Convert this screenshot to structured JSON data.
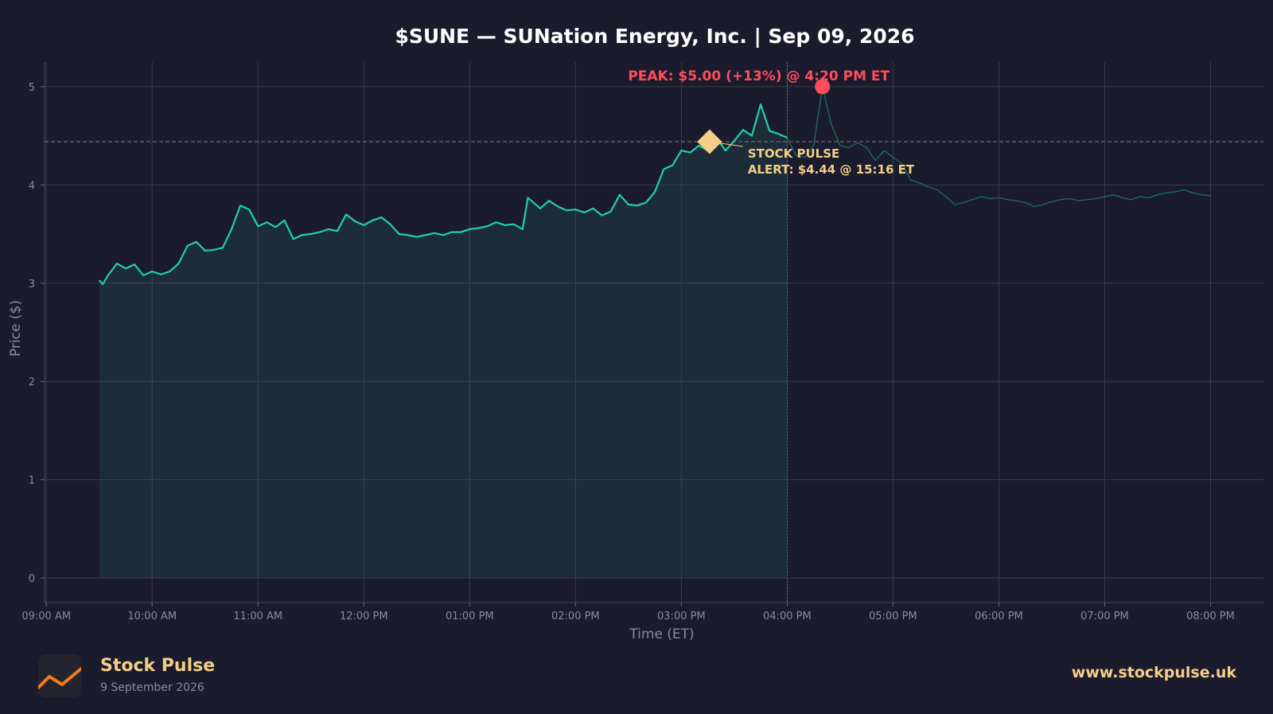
{
  "chart_data": {
    "type": "line",
    "title": "$SUNE — SUNation Energy, Inc.  |  Sep 09, 2026",
    "xlabel": "Time (ET)",
    "ylabel": "Price ($)",
    "ylim": [
      -0.25,
      5.25
    ],
    "yticks": [
      0,
      1,
      2,
      3,
      4,
      5
    ],
    "xlim": [
      "08:59",
      "20:30"
    ],
    "x_tick_labels": [
      "09:00 AM",
      "10:00 AM",
      "11:00 AM",
      "12:00 PM",
      "01:00 PM",
      "02:00 PM",
      "03:00 PM",
      "04:00 PM",
      "05:00 PM",
      "06:00 PM",
      "07:00 PM",
      "08:00 PM"
    ],
    "x_tick_times": [
      "09:00",
      "10:00",
      "11:00",
      "12:00",
      "13:00",
      "14:00",
      "15:00",
      "16:00",
      "17:00",
      "18:00",
      "19:00",
      "20:00"
    ],
    "grid": true,
    "market_close": "16:00",
    "series": [
      {
        "session": "regular",
        "color": "#1fd1a6",
        "points": [
          [
            "09:30",
            3.03
          ],
          [
            "09:32",
            2.99
          ],
          [
            "09:35",
            3.08
          ],
          [
            "09:40",
            3.2
          ],
          [
            "09:45",
            3.15
          ],
          [
            "09:50",
            3.19
          ],
          [
            "09:55",
            3.08
          ],
          [
            "10:00",
            3.12
          ],
          [
            "10:05",
            3.09
          ],
          [
            "10:10",
            3.12
          ],
          [
            "10:15",
            3.2
          ],
          [
            "10:20",
            3.38
          ],
          [
            "10:25",
            3.42
          ],
          [
            "10:30",
            3.33
          ],
          [
            "10:35",
            3.34
          ],
          [
            "10:40",
            3.36
          ],
          [
            "10:45",
            3.55
          ],
          [
            "10:50",
            3.79
          ],
          [
            "10:55",
            3.75
          ],
          [
            "11:00",
            3.58
          ],
          [
            "11:05",
            3.62
          ],
          [
            "11:10",
            3.57
          ],
          [
            "11:15",
            3.64
          ],
          [
            "11:20",
            3.45
          ],
          [
            "11:25",
            3.49
          ],
          [
            "11:30",
            3.5
          ],
          [
            "11:35",
            3.52
          ],
          [
            "11:40",
            3.55
          ],
          [
            "11:45",
            3.53
          ],
          [
            "11:50",
            3.7
          ],
          [
            "11:55",
            3.63
          ],
          [
            "12:00",
            3.59
          ],
          [
            "12:05",
            3.64
          ],
          [
            "12:10",
            3.67
          ],
          [
            "12:15",
            3.6
          ],
          [
            "12:20",
            3.5
          ],
          [
            "12:25",
            3.49
          ],
          [
            "12:30",
            3.47
          ],
          [
            "12:35",
            3.49
          ],
          [
            "12:40",
            3.51
          ],
          [
            "12:45",
            3.49
          ],
          [
            "12:50",
            3.52
          ],
          [
            "12:55",
            3.52
          ],
          [
            "13:00",
            3.55
          ],
          [
            "13:05",
            3.56
          ],
          [
            "13:10",
            3.58
          ],
          [
            "13:15",
            3.62
          ],
          [
            "13:20",
            3.59
          ],
          [
            "13:25",
            3.6
          ],
          [
            "13:30",
            3.55
          ],
          [
            "13:33",
            3.87
          ],
          [
            "13:40",
            3.76
          ],
          [
            "13:45",
            3.84
          ],
          [
            "13:50",
            3.78
          ],
          [
            "13:55",
            3.74
          ],
          [
            "14:00",
            3.75
          ],
          [
            "14:05",
            3.72
          ],
          [
            "14:10",
            3.76
          ],
          [
            "14:15",
            3.69
          ],
          [
            "14:20",
            3.73
          ],
          [
            "14:25",
            3.9
          ],
          [
            "14:30",
            3.8
          ],
          [
            "14:35",
            3.79
          ],
          [
            "14:40",
            3.82
          ],
          [
            "14:45",
            3.93
          ],
          [
            "14:50",
            4.16
          ],
          [
            "14:55",
            4.2
          ],
          [
            "15:00",
            4.35
          ],
          [
            "15:05",
            4.33
          ],
          [
            "15:10",
            4.4
          ],
          [
            "15:15",
            4.35
          ],
          [
            "15:20",
            4.48
          ],
          [
            "15:25",
            4.35
          ],
          [
            "15:30",
            4.45
          ],
          [
            "15:35",
            4.56
          ],
          [
            "15:40",
            4.5
          ],
          [
            "15:45",
            4.82
          ],
          [
            "15:50",
            4.55
          ],
          [
            "15:55",
            4.52
          ],
          [
            "16:00",
            4.48
          ]
        ]
      },
      {
        "session": "after-hours",
        "color": "#1a6b5b",
        "points": [
          [
            "16:00",
            4.48
          ],
          [
            "16:05",
            4.3
          ],
          [
            "16:10",
            4.28
          ],
          [
            "16:15",
            4.4
          ],
          [
            "16:20",
            5.0
          ],
          [
            "16:25",
            4.62
          ],
          [
            "16:30",
            4.4
          ],
          [
            "16:35",
            4.38
          ],
          [
            "16:40",
            4.43
          ],
          [
            "16:45",
            4.38
          ],
          [
            "16:50",
            4.25
          ],
          [
            "16:55",
            4.35
          ],
          [
            "17:00",
            4.28
          ],
          [
            "17:05",
            4.22
          ],
          [
            "17:10",
            4.05
          ],
          [
            "17:15",
            4.02
          ],
          [
            "17:20",
            3.98
          ],
          [
            "17:25",
            3.95
          ],
          [
            "17:30",
            3.88
          ],
          [
            "17:35",
            3.8
          ],
          [
            "17:40",
            3.82
          ],
          [
            "17:45",
            3.85
          ],
          [
            "17:50",
            3.88
          ],
          [
            "17:55",
            3.86
          ],
          [
            "18:00",
            3.87
          ],
          [
            "18:05",
            3.85
          ],
          [
            "18:10",
            3.84
          ],
          [
            "18:15",
            3.82
          ],
          [
            "18:20",
            3.78
          ],
          [
            "18:25",
            3.8
          ],
          [
            "18:30",
            3.83
          ],
          [
            "18:35",
            3.85
          ],
          [
            "18:40",
            3.86
          ],
          [
            "18:45",
            3.84
          ],
          [
            "18:50",
            3.85
          ],
          [
            "18:55",
            3.86
          ],
          [
            "19:00",
            3.88
          ],
          [
            "19:05",
            3.9
          ],
          [
            "19:10",
            3.87
          ],
          [
            "19:15",
            3.85
          ],
          [
            "19:20",
            3.88
          ],
          [
            "19:25",
            3.87
          ],
          [
            "19:30",
            3.9
          ],
          [
            "19:35",
            3.92
          ],
          [
            "19:40",
            3.93
          ],
          [
            "19:45",
            3.95
          ],
          [
            "19:50",
            3.92
          ],
          [
            "19:55",
            3.9
          ],
          [
            "20:00",
            3.89
          ]
        ]
      }
    ],
    "alert_line": {
      "y": 4.44
    },
    "alert": {
      "time": "15:16",
      "price": 4.44,
      "label_line1": "STOCK PULSE",
      "label_line2": "ALERT: $4.44 @ 15:16 ET",
      "color": "#f3cf86"
    },
    "peak": {
      "time": "16:20",
      "price": 5.0,
      "label": "PEAK: $5.00 (+13%) @ 4:20 PM ET",
      "color": "#ff4d5a"
    }
  },
  "footer": {
    "brand_name": "Stock Pulse",
    "brand_date": "9 September 2026",
    "url": "www.stockpulse.uk",
    "logo_icon": "trend-line-icon"
  }
}
